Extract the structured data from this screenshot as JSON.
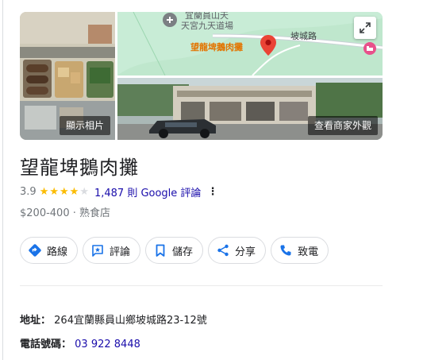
{
  "photos": {
    "view_photos_label": "顯示相片",
    "view_exterior_label": "查看商家外觀",
    "map": {
      "top_label": "宜蘭員山天",
      "temple_label": "天宮九天道場",
      "road_label": "坡城路",
      "pin_label": "望龍埤鵝肉攤"
    }
  },
  "place": {
    "name": "望龍埤鵝肉攤",
    "rating": "3.9",
    "stars": {
      "filled": 4,
      "total": 5
    },
    "reviews_text": "1,487 則 Google 評論",
    "price_range": "$200-400",
    "separator": "·",
    "category": "熟食店"
  },
  "actions": [
    {
      "name": "directions",
      "label": "路線",
      "icon": "directions-icon"
    },
    {
      "name": "review",
      "label": "評論",
      "icon": "review-icon"
    },
    {
      "name": "save",
      "label": "儲存",
      "icon": "bookmark-icon"
    },
    {
      "name": "share",
      "label": "分享",
      "icon": "share-icon"
    },
    {
      "name": "call",
      "label": "致電",
      "icon": "phone-icon"
    }
  ],
  "details": {
    "address_label": "地址：",
    "address": "264宜蘭縣員山鄉坡城路23-12號",
    "phone_label": "電話號碼：",
    "phone": "03 922 8448"
  },
  "colors": {
    "link": "#1a0dab",
    "star": "#fbbc04",
    "accent_blue": "#1a73e8",
    "pin_red": "#ea4335"
  }
}
